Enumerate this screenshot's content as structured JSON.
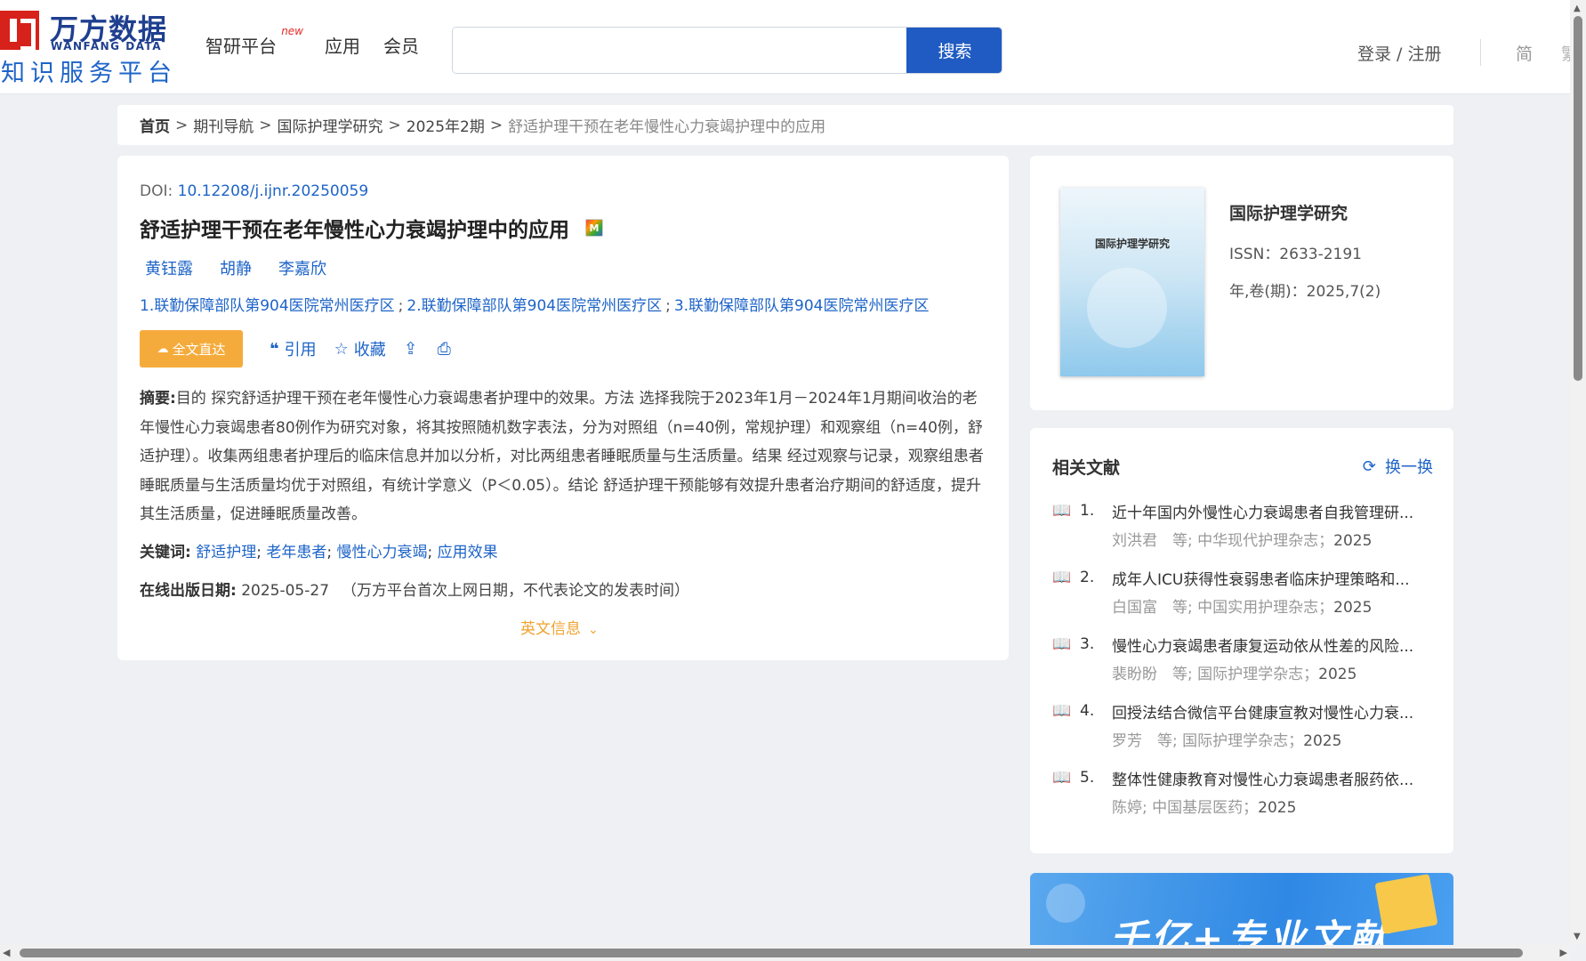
{
  "header": {
    "logo_cn": "万方数据",
    "logo_en": "WANFANG DATA",
    "logo_sub": "知识服务平台",
    "nav": [
      {
        "label": "智研平台",
        "badge": "new"
      },
      {
        "label": "应用"
      },
      {
        "label": "会员"
      }
    ],
    "search_placeholder": "",
    "search_button": "搜索",
    "login": "登录 / 注册",
    "lang_simplified": "简",
    "lang_traditional": "繁"
  },
  "breadcrumb": {
    "home": "首页",
    "items": [
      "期刊导航",
      "国际护理学研究",
      "2025年2期"
    ],
    "current": "舒适护理干预在老年慢性心力衰竭护理中的应用",
    "separator": ">"
  },
  "article": {
    "doi_label": "DOI: ",
    "doi": "10.12208/j.ijnr.20250059",
    "title": "舒适护理干预在老年慢性心力衰竭护理中的应用",
    "m_badge": "M",
    "authors": [
      "黄钰露",
      "胡静",
      "李嘉欣"
    ],
    "affiliations": [
      "1.联勤保障部队第904医院常州医疗区",
      "2.联勤保障部队第904医院常州医疗区",
      "3.联勤保障部队第904医院常州医疗区"
    ],
    "affiliation_sep": ";",
    "actions": {
      "fulltext": "全文直达",
      "fulltext_icon": "cloud-icon",
      "cite": "引用",
      "favorite": "收藏"
    },
    "abstract_label": "摘要:",
    "abstract": "目的 探究舒适护理干预在老年慢性心力衰竭患者护理中的效果。方法 选择我院于2023年1月－2024年1月期间收治的老年慢性心力衰竭患者80例作为研究对象，将其按照随机数字表法，分为对照组（n=40例，常规护理）和观察组（n=40例，舒适护理）。收集两组患者护理后的临床信息并加以分析，对比两组患者睡眠质量与生活质量。结果 经过观察与记录，观察组患者睡眠质量与生活质量均优于对照组，有统计学意义（P＜0.05）。结论 舒适护理干预能够有效提升患者治疗期间的舒适度，提升其生活质量，促进睡眠质量改善。",
    "keywords_label": "关键词:",
    "keywords": [
      "舒适护理",
      "老年患者",
      "慢性心力衰竭",
      "应用效果"
    ],
    "pubdate_label": "在线出版日期:",
    "pubdate": "2025-05-27",
    "pubdate_note": "（万方平台首次上网日期，不代表论文的发表时间）",
    "english_info": "英文信息"
  },
  "journal": {
    "cover_title": "国际护理学研究",
    "name": "国际护理学研究",
    "issn": "ISSN：2633-2191",
    "volume": "年,卷(期)：2025,7(2)"
  },
  "related": {
    "header": "相关文献",
    "refresh": "换一换",
    "items": [
      {
        "num": "1.",
        "title": "近十年国内外慢性心力衰竭患者自我管理研...",
        "meta": "刘洪君　等;  中华现代护理杂志；",
        "year": "2025"
      },
      {
        "num": "2.",
        "title": "成年人ICU获得性衰弱患者临床护理策略和...",
        "meta": "白国富　等;  中国实用护理杂志；",
        "year": "2025"
      },
      {
        "num": "3.",
        "title": "慢性心力衰竭患者康复运动依从性差的风险...",
        "meta": "裴盼盼　等;  国际护理学杂志；",
        "year": "2025"
      },
      {
        "num": "4.",
        "title": "回授法结合微信平台健康宣教对慢性心力衰...",
        "meta": "罗芳　等;  国际护理学杂志；",
        "year": "2025"
      },
      {
        "num": "5.",
        "title": "整体性健康教育对慢性心力衰竭患者服药依...",
        "meta": "陈婷;  中国基层医药；",
        "year": "2025"
      }
    ]
  },
  "banner": {
    "text": "千亿+专业文献"
  }
}
